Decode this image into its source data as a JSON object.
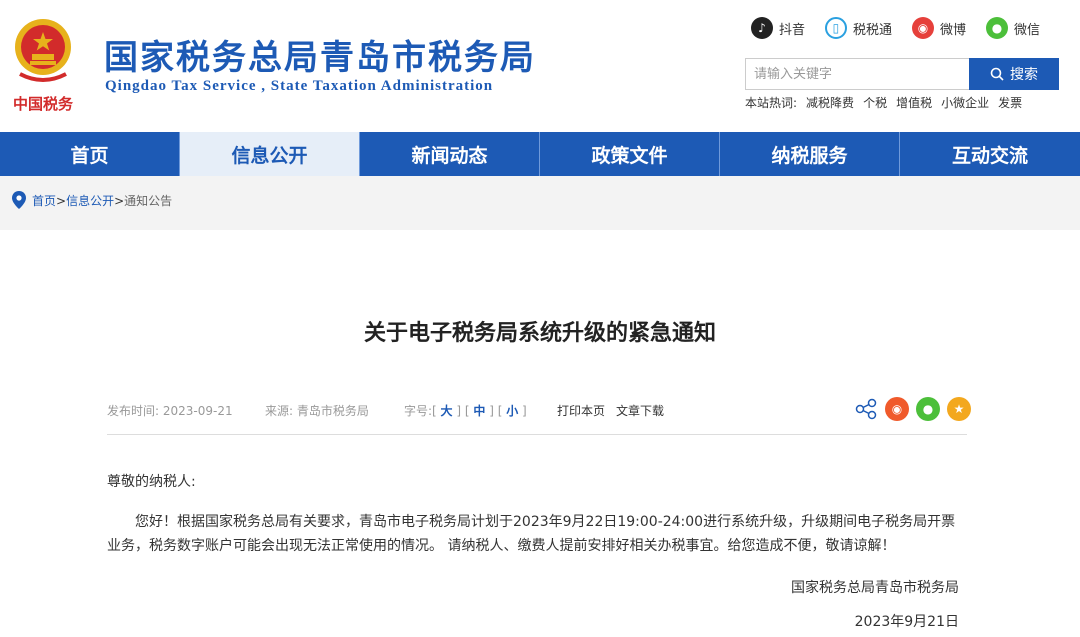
{
  "header": {
    "emblem_text": "中国税务",
    "title": "国家税务总局青岛市税务局",
    "subtitle": "Qingdao Tax Service , State Taxation Administration"
  },
  "social": [
    {
      "label": "抖音",
      "icon": "douyin-icon",
      "color": "#222222"
    },
    {
      "label": "税税通",
      "icon": "phone-icon",
      "color": "#2aa0e0"
    },
    {
      "label": "微博",
      "icon": "weibo-icon",
      "color": "#e6403b"
    },
    {
      "label": "微信",
      "icon": "wechat-icon",
      "color": "#4cbf3a"
    }
  ],
  "search": {
    "placeholder": "请输入关键字",
    "button_label": "搜索"
  },
  "hot": {
    "label": "本站热词:",
    "items": [
      "减税降费",
      "个税",
      "增值税",
      "小微企业",
      "发票"
    ]
  },
  "nav": {
    "items": [
      "首页",
      "信息公开",
      "新闻动态",
      "政策文件",
      "纳税服务",
      "互动交流"
    ],
    "active_index": 1
  },
  "breadcrumb": {
    "items": [
      "首页",
      "信息公开",
      "通知公告"
    ]
  },
  "article": {
    "title": "关于电子税务局系统升级的紧急通知",
    "meta": {
      "publish_time": "发布时间: 2023-09-21",
      "source": "来源: 青岛市税务局",
      "font_label": "字号:",
      "font_sizes": [
        "大",
        "中",
        "小"
      ],
      "print": "打印本页",
      "download": "文章下载"
    },
    "salutation": "尊敬的纳税人:",
    "paragraph": "您好！根据国家税务总局有关要求，青岛市电子税务局计划于2023年9月22日19:00-24:00进行系统升级，升级期间电子税务局开票业务，税务数字账户可能会出现无法正常使用的情况。 请纳税人、缴费人提前安排好相关办税事宜。给您造成不便，敬请谅解！",
    "signature": "国家税务总局青岛市税务局",
    "date": "2023年9月21日"
  },
  "colors": {
    "brand": "#1d5ab5",
    "nav_active_bg": "#e6eef8",
    "emblem_red": "#d22b2b",
    "emblem_gold": "#e7b21c"
  }
}
